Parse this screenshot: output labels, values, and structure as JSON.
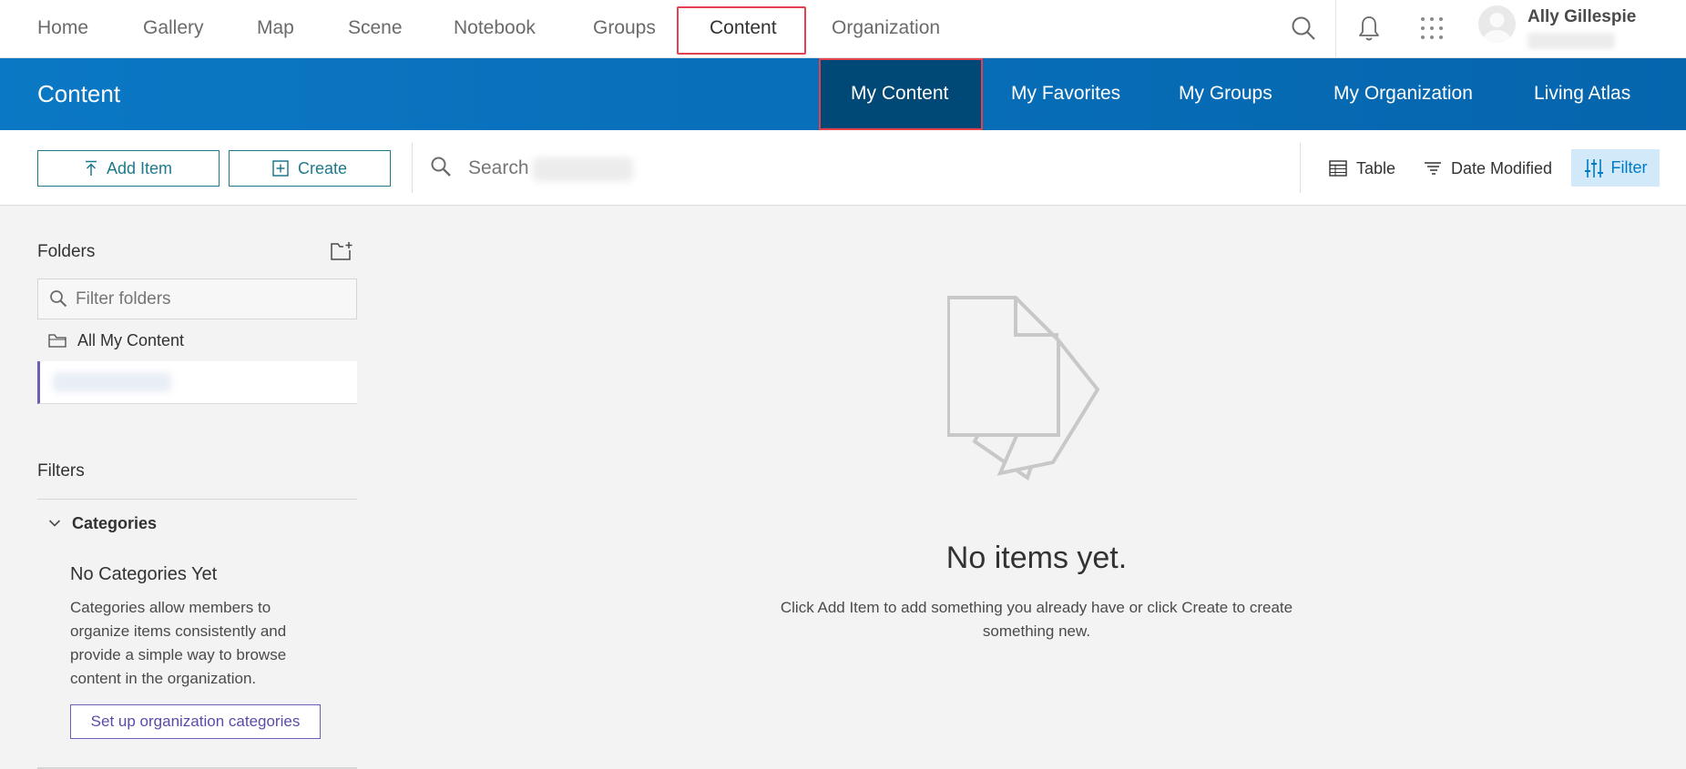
{
  "topnav": {
    "items": [
      "Home",
      "Gallery",
      "Map",
      "Scene",
      "Notebook",
      "Groups",
      "Content",
      "Organization"
    ],
    "active": "Content",
    "user_name": "Ally Gillespie"
  },
  "header": {
    "title": "Content",
    "tabs": [
      "My Content",
      "My Favorites",
      "My Groups",
      "My Organization",
      "Living Atlas"
    ],
    "active_tab": "My Content"
  },
  "toolbar": {
    "add_item_label": "Add Item",
    "create_label": "Create",
    "search_placeholder": "Search",
    "view_label": "Table",
    "sort_label": "Date Modified",
    "filter_label": "Filter"
  },
  "sidebar": {
    "folders_heading": "Folders",
    "filter_folders_placeholder": "Filter folders",
    "all_content_label": "All My Content",
    "filters_heading": "Filters",
    "categories_label": "Categories",
    "no_categories_title": "No Categories Yet",
    "no_categories_desc": "Categories allow members to organize items consistently and provide a simple way to browse content in the organization.",
    "setup_button_label": "Set up organization categories"
  },
  "empty_state": {
    "title": "No items yet.",
    "description": "Click Add Item to add something you already have or click Create to create something new."
  },
  "colors": {
    "header_blue": "#0b78c5",
    "active_tab": "#004875",
    "highlight_red": "#e2414d",
    "teal_button": "#1d7a8c",
    "purple_accent": "#6e5cb6"
  }
}
